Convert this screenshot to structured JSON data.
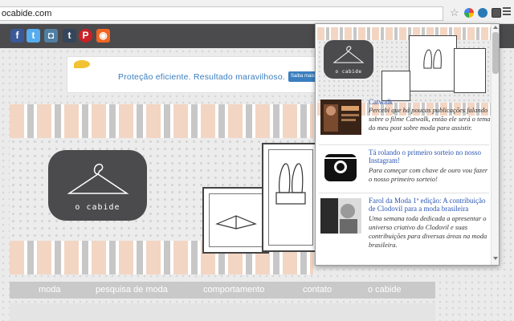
{
  "browser": {
    "url": "ocabide.com"
  },
  "site": {
    "ad_text": "Proteção eficiente. Resultado maravilhoso.",
    "ad_button": "Saiba mais",
    "logo_text": "o cabide",
    "nav": [
      "moda",
      "pesquisa de moda",
      "comportamento",
      "contato",
      "o cabide"
    ]
  },
  "popup": {
    "logo_text": "o cabide",
    "posts": [
      {
        "title": "Catwalk",
        "desc": "Percebi que há poucas publicações falando sobre o filme Catwalk, então ele será o tema do meu post sobre moda para assistir."
      },
      {
        "title": "Tá rolando o primeiro sorteio no nosso Instagram!",
        "desc": "Para começar com chave de ouro vou fazer o nosso primeiro sorteio!"
      },
      {
        "title": "Farol da Moda 1ª edição: A contribuição de Clodovil para a moda brasileira",
        "desc": "Uma semana toda dedicada a apresentar o universo criativo do Clodovil e suas contribuições para diversas áreas na moda brasileira."
      }
    ]
  },
  "colors": {
    "dark": "#4b4a4c",
    "peach": "#f2d5c3",
    "link": "#2a56b5"
  }
}
